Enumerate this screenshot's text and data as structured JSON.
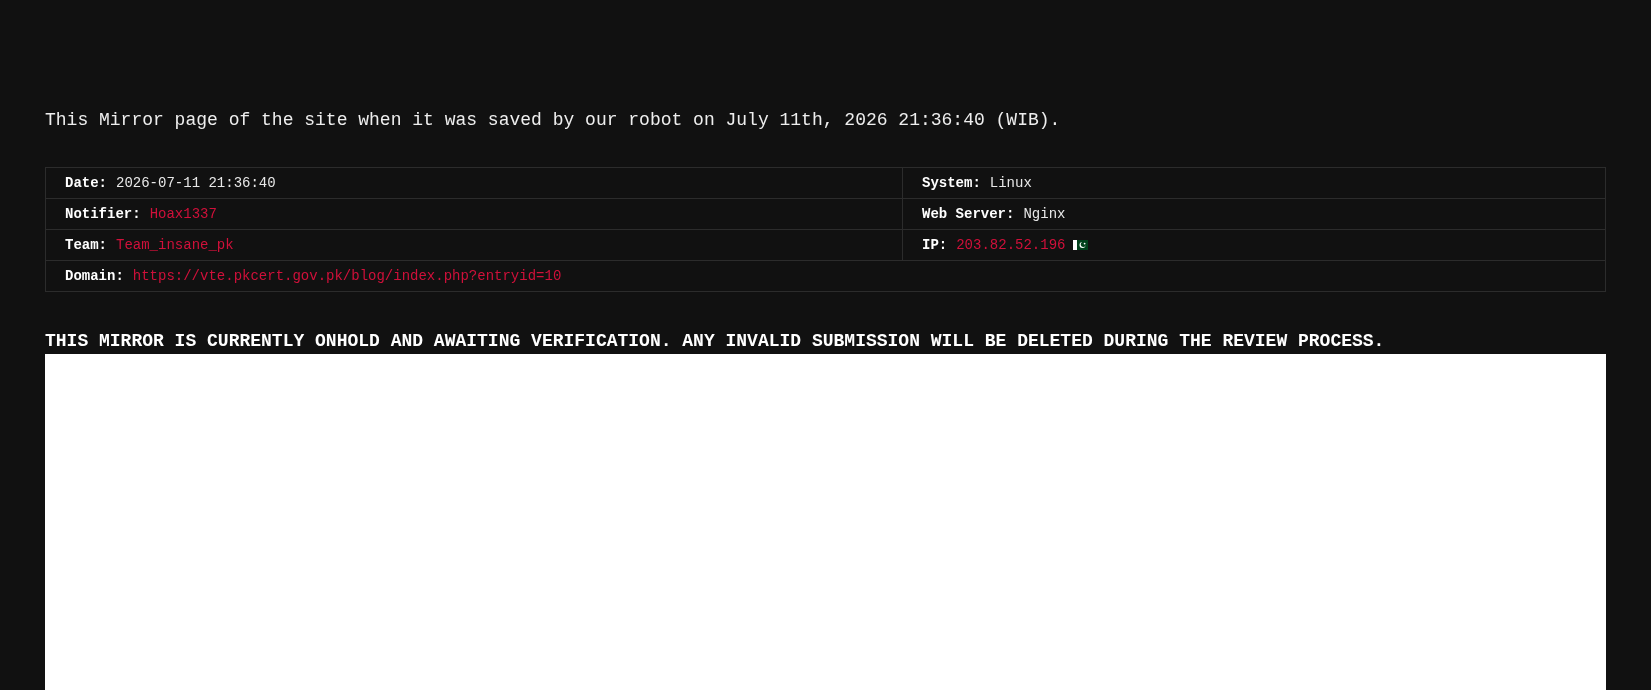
{
  "intro": "This Mirror page of the site when it was saved by our robot on July 11th, 2026 21:36:40 (WIB).",
  "details": {
    "rows": [
      [
        {
          "label": "Date:",
          "value": "2026-07-11 21:36:40",
          "kind": "plain"
        },
        {
          "label": "System:",
          "value": "Linux",
          "kind": "plain"
        }
      ],
      [
        {
          "label": "Notifier:",
          "value": "Hoax1337",
          "kind": "link"
        },
        {
          "label": "Web Server:",
          "value": "Nginx",
          "kind": "plain"
        }
      ],
      [
        {
          "label": "Team:",
          "value": "Team_insane_pk",
          "kind": "link"
        },
        {
          "label": "IP:",
          "value": "203.82.52.196",
          "kind": "ip"
        }
      ],
      [
        {
          "label": "Domain:",
          "value": "https://vte.pkcert.gov.pk/blog/index.php?entryid=10",
          "kind": "link",
          "colspan": 2
        }
      ]
    ]
  },
  "notice": "THIS MIRROR IS CURRENTLY ONHOLD AND AWAITING VERIFICATION. ANY INVALID SUBMISSION WILL BE DELETED DURING THE REVIEW PROCESS."
}
